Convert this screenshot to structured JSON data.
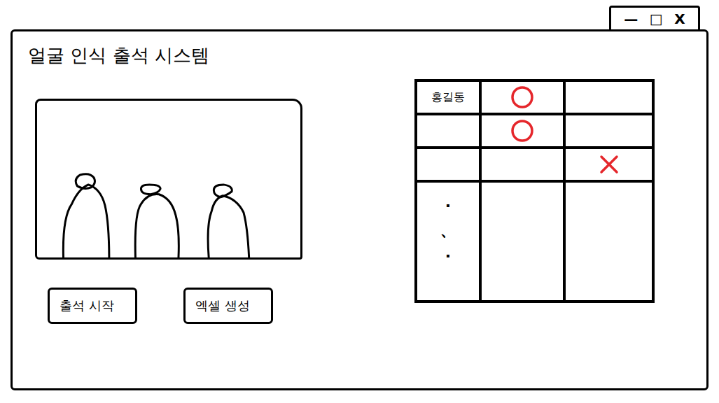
{
  "window": {
    "title": "얼굴 인식 출석 시스템",
    "controls": [
      "—",
      "□",
      "X"
    ]
  },
  "buttons": [
    {
      "label": "출석 시작"
    },
    {
      "label": "엑셀 생성"
    }
  ],
  "table": {
    "rows": [
      {
        "lines": [
          "홍길동"
        ],
        "cells": [
          {
            "mark": "circle"
          },
          {
            "mark": "none"
          }
        ]
      },
      {
        "lines": [],
        "cells": [
          {
            "mark": "circle"
          },
          {
            "mark": "none"
          }
        ]
      },
      {
        "lines": [],
        "cells": [
          {
            "mark": "none"
          },
          {
            "mark": "cross"
          }
        ]
      },
      {
        "lines": [
          "·",
          "、",
          "·"
        ],
        "cells": [
          {
            "mark": "none"
          },
          {
            "mark": "none"
          }
        ]
      }
    ]
  }
}
